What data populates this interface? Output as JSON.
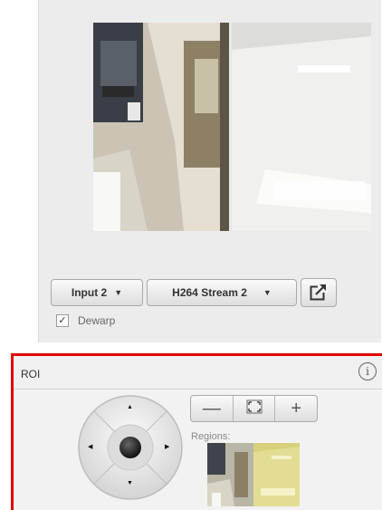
{
  "video": {
    "input_select": {
      "label": "Input 2",
      "caret": "▼"
    },
    "stream_select": {
      "label": "H264 Stream 2",
      "caret": "▼"
    },
    "popout_icon": "popout-icon",
    "dewarp": {
      "label": "Dewarp",
      "checked": true,
      "check_glyph": "✓"
    }
  },
  "roi": {
    "title": "ROI",
    "info_glyph": "i",
    "zoom": {
      "out": "—",
      "fit": "fit-icon",
      "in": "+"
    },
    "regions_label": "Regions:"
  },
  "colors": {
    "accent": "#e00000",
    "panel": "#ececec"
  }
}
